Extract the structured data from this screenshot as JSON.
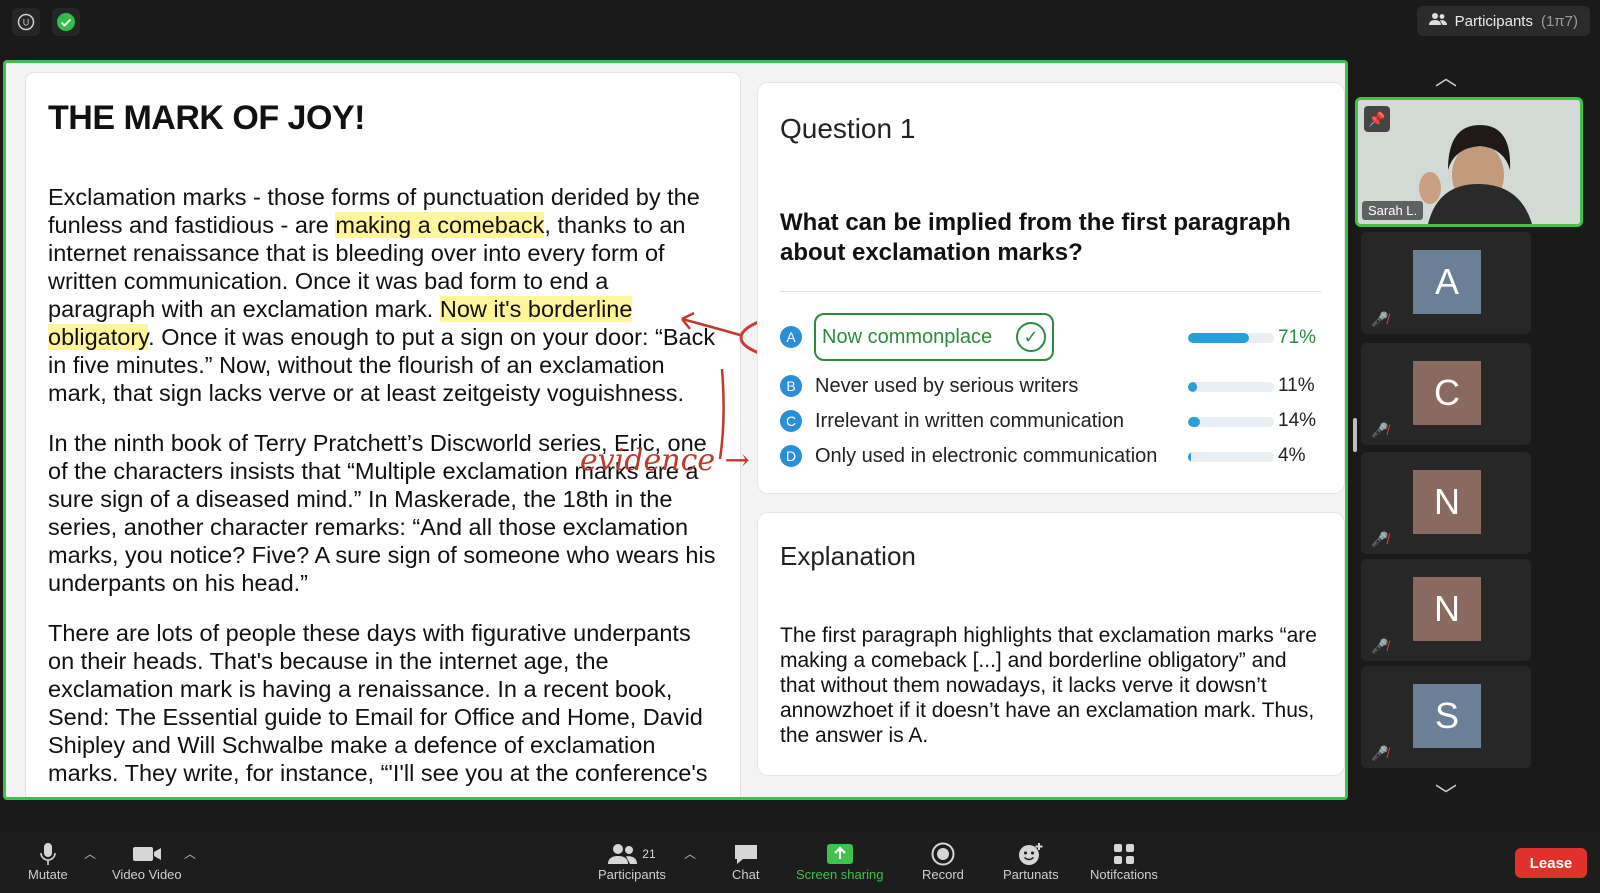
{
  "topbar": {
    "participants_label": "Participants",
    "participants_count": "(1π7)"
  },
  "article": {
    "title": "THE MARK OF JOY!",
    "p1_a": "Exclamation marks - those forms of punctuation derided by the funless and fastidious - are ",
    "p1_hl1": "making a comeback",
    "p1_b": ", thanks to an internet renaissance that is bleeding over into every form of written communication. Once it was bad form to end a paragraph with an exclamation mark. ",
    "p1_hl2": "Now it's borderline obligatory",
    "p1_c": ". Once it was enough to put a sign on your door: “Back in five minutes.” Now, without the flourish of an exclamation mark, that sign lacks verve or at least zeitgeisty voguishness.",
    "p2": "In the ninth book of Terry Pratchett’s Discworld series, Eric, one of the characters insists that “Multiple exclamation marks are a sure sign of a diseased mind.” In Maskerade, the 18th in the series, another character remarks: “And all those exclamation marks, you notice? Five? A sure sign of someone who wears his underpants on his head.”",
    "p3": "There are lots of people these days with figurative underpants on their heads. That's because in the internet age, the exclamation mark is having a renaissance. In a recent book, Send: The Essential guide to Email for Office and Home, David Shipley and Will Schwalbe make a defence of exclamation marks. They write, for instance, “'I'll see you at the conference's",
    "annotation": "evidence →"
  },
  "question": {
    "number": "Question 1",
    "text": "What can be implied from the first paragraph about exclamation marks?",
    "options": [
      {
        "letter": "A",
        "label": "Now commonplace",
        "pct": "71%",
        "fraction": 0.71
      },
      {
        "letter": "B",
        "label": "Never used by serious writers",
        "pct": "11%",
        "fraction": 0.11
      },
      {
        "letter": "C",
        "label": "Irrelevant in written communication",
        "pct": "14%",
        "fraction": 0.14
      },
      {
        "letter": "D",
        "label": "Only used in electronic communication",
        "pct": "4%",
        "fraction": 0.04
      }
    ]
  },
  "explanation": {
    "title": "Explanation",
    "text": "The first paragraph highlights that exclamation marks “are making a comeback [...] and borderline obligatory” and that without them nowadays, it lacks verve it dowsn’t annowzhoet if it doesn’t have an exclamation mark. Thus, the answer is A."
  },
  "sidebar": {
    "self_name": "Sarah L.",
    "tiles": [
      {
        "initial": "A",
        "color": "#6b7f96"
      },
      {
        "initial": "C",
        "color": "#8a6a60"
      },
      {
        "initial": "N",
        "color": "#8a6a60"
      },
      {
        "initial": "N",
        "color": "#8a6a60"
      },
      {
        "initial": "S",
        "color": "#6b7f96"
      }
    ]
  },
  "toolbar": {
    "mute": "Mutate",
    "video": "Video Video",
    "participants": "Participants",
    "participants_count": "21",
    "chat": "Chat",
    "share": "Screen sharing",
    "record": "Record",
    "partunats": "Partunats",
    "notifications": "Notifcations",
    "leave": "Lease"
  },
  "colors": {
    "accent_green": "#3ec24b",
    "bar_blue": "#2a9ed8",
    "highlight": "#fff59a",
    "annotation_red": "#c0392b",
    "leave_red": "#e0322a"
  }
}
